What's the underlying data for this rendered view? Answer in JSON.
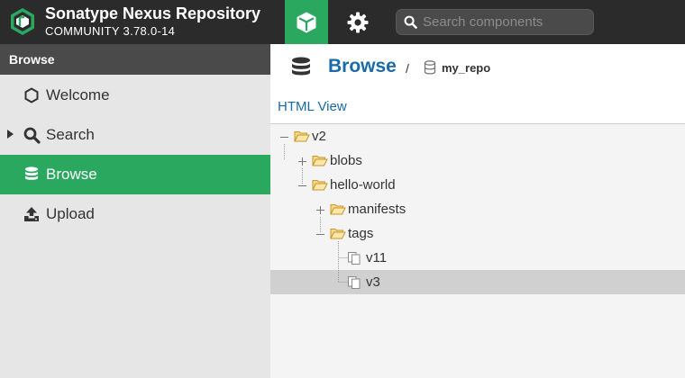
{
  "header": {
    "app_title": "Sonatype Nexus Repository",
    "app_version": "COMMUNITY 3.78.0-14",
    "search_placeholder": "Search components",
    "browse_mode_icon": "cube-icon",
    "admin_mode_icon": "gear-icon",
    "colors": {
      "bar": "#2b2b2b",
      "active": "#2aa860"
    }
  },
  "sidebar": {
    "header": "Browse",
    "items": [
      {
        "label": "Welcome",
        "icon": "hexagon-icon",
        "selected": false,
        "expandable": false
      },
      {
        "label": "Search",
        "icon": "search-icon",
        "selected": false,
        "expandable": true
      },
      {
        "label": "Browse",
        "icon": "database-icon",
        "selected": true,
        "expandable": false
      },
      {
        "label": "Upload",
        "icon": "upload-icon",
        "selected": false,
        "expandable": false
      }
    ]
  },
  "main": {
    "breadcrumb": {
      "title": "Browse",
      "separator": "/",
      "repo": "my_repo"
    },
    "html_view": "HTML View",
    "tree": [
      {
        "label": "v2",
        "type": "folder",
        "expanded": true
      },
      {
        "label": "blobs",
        "type": "folder",
        "expanded": false
      },
      {
        "label": "hello-world",
        "type": "folder",
        "expanded": true
      },
      {
        "label": "manifests",
        "type": "folder",
        "expanded": false
      },
      {
        "label": "tags",
        "type": "folder",
        "expanded": true
      },
      {
        "label": "v11",
        "type": "file"
      },
      {
        "label": "v3",
        "type": "file",
        "selected": true
      }
    ]
  }
}
